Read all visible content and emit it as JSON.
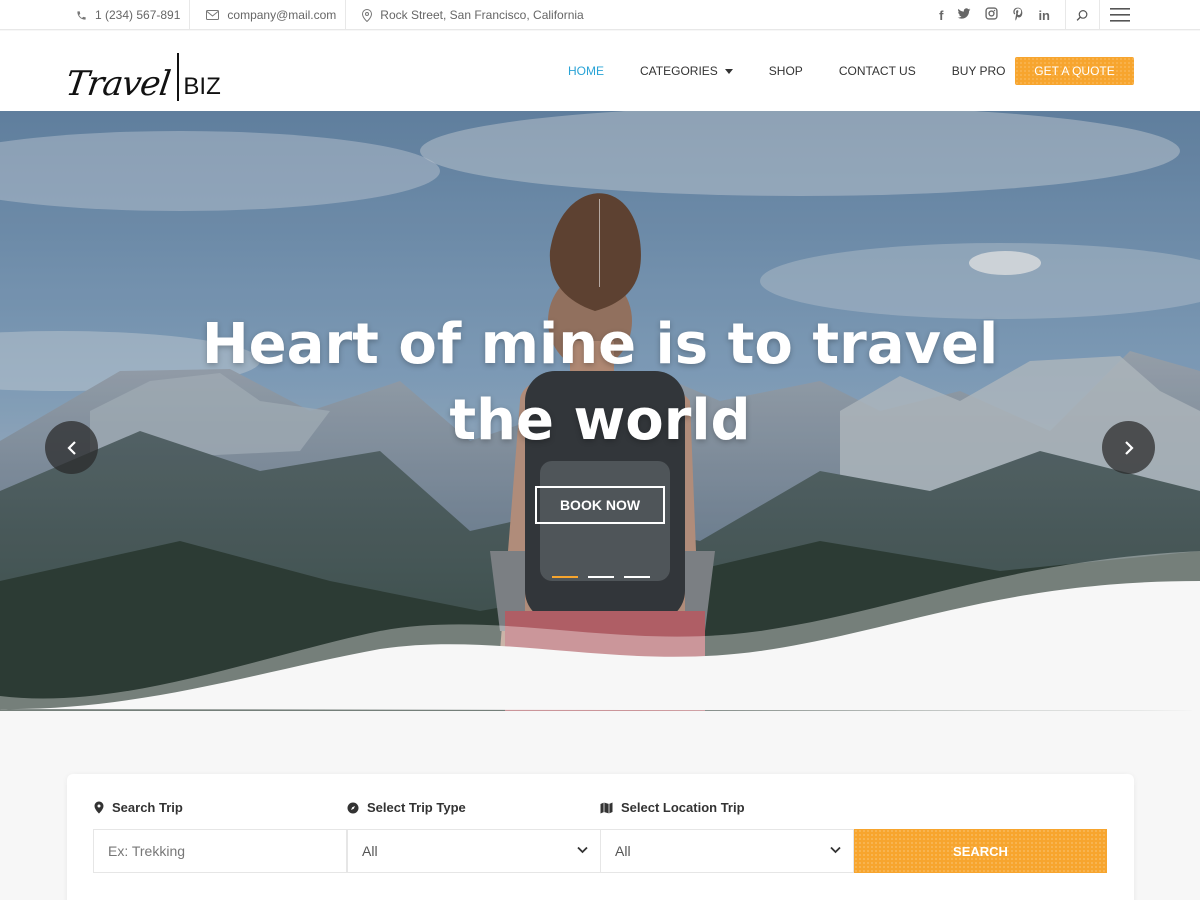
{
  "topbar": {
    "phone": "1 (234) 567-891",
    "email": "company@mail.com",
    "address": "Rock Street, San Francisco, California",
    "social": [
      "facebook-icon",
      "twitter-icon",
      "instagram-icon",
      "pinterest-icon",
      "linkedin-icon"
    ]
  },
  "header": {
    "logo_script": "Travel",
    "logo_biz": "BIZ",
    "nav": [
      {
        "label": "HOME"
      },
      {
        "label": "CATEGORIES"
      },
      {
        "label": "SHOP"
      },
      {
        "label": "CONTACT US"
      },
      {
        "label": "BUY PRO"
      }
    ],
    "quote_label": "GET A QUOTE"
  },
  "hero": {
    "title_line1": "Heart of mine is to travel",
    "title_line2": "the world",
    "cta": "BOOK NOW",
    "slides": 3,
    "active_slide": 1
  },
  "search": {
    "trip_label": "Search Trip",
    "trip_placeholder": "Ex: Trekking",
    "type_label": "Select Trip Type",
    "type_value": "All",
    "location_label": "Select Location Trip",
    "location_value": "All",
    "button": "SEARCH"
  },
  "colors": {
    "accent": "#f7a52e",
    "nav_active": "#29a3d6"
  }
}
